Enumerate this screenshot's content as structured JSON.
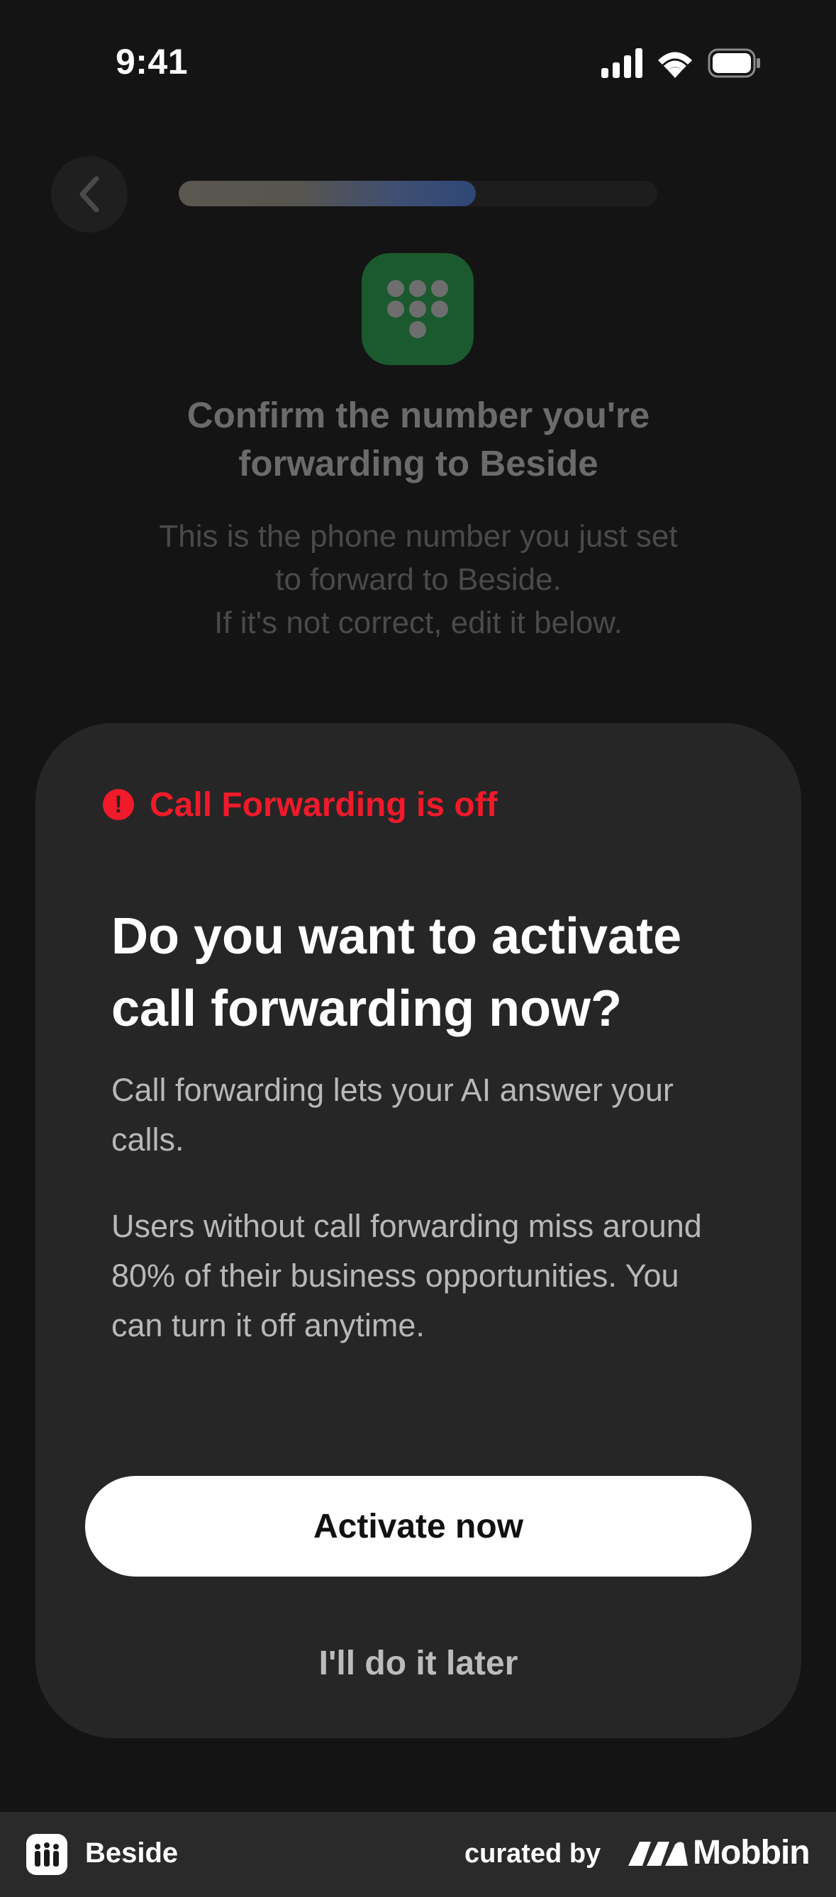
{
  "status_bar": {
    "time": "9:41",
    "icons": [
      "signal-icon",
      "wifi-icon",
      "battery-icon"
    ]
  },
  "background_screen": {
    "back_icon": "chevron-left-icon",
    "progress": 0.62,
    "app_icon": "dialpad-icon",
    "title": "Confirm the number you're forwarding to Beside",
    "subtitle_lines": [
      "This is the phone number you just set",
      "to forward to Beside.",
      "If it's not correct, edit it below."
    ]
  },
  "sheet": {
    "status_icon": "alert-icon",
    "status_text": "Call Forwarding is off",
    "title": "Do you want to activate call forwarding now?",
    "body1": "Call forwarding lets your AI answer your calls.",
    "body2": "Users without call forwarding miss around 80% of their business opportunities. You can turn it off anytime.",
    "primary_button": "Activate now",
    "secondary_button": "I'll do it later"
  },
  "footer": {
    "app_name": "Beside",
    "curated_by": "curated by",
    "brand": "Mobbin"
  },
  "colors": {
    "background": "#141414",
    "sheet": "#262626",
    "alert": "#f01a2a",
    "app_icon": "#1a5a2e"
  }
}
